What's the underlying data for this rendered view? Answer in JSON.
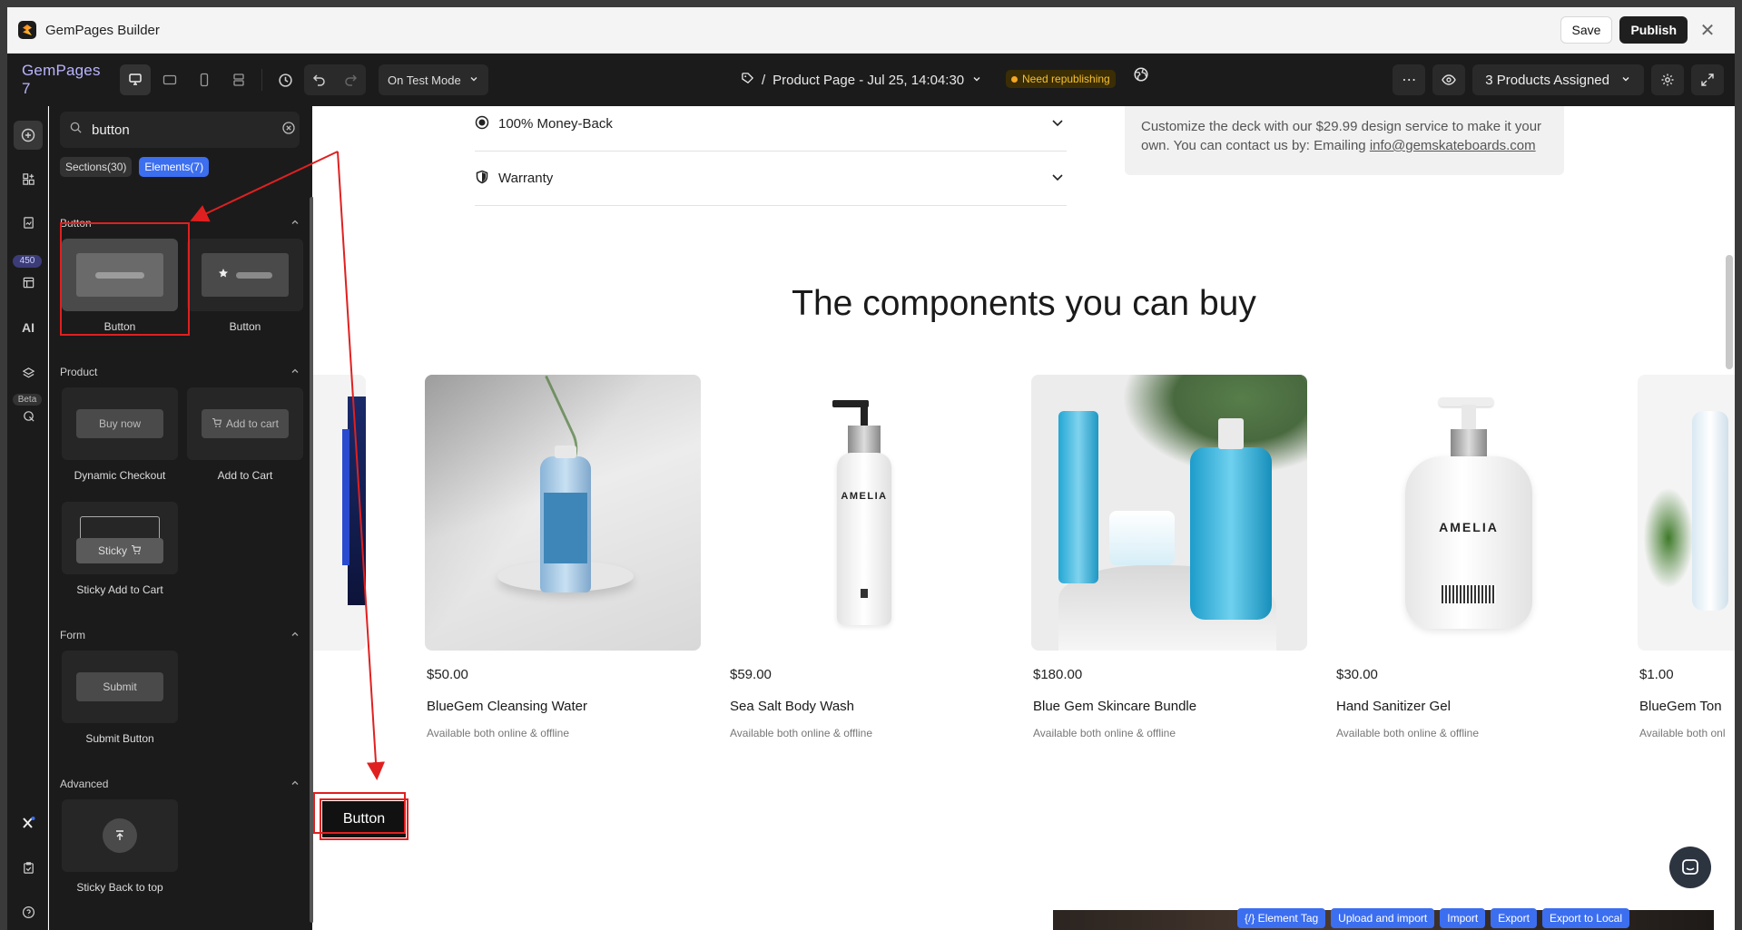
{
  "window": {
    "title": "GemPages Builder",
    "save_label": "Save",
    "publish_label": "Publish"
  },
  "toolbar": {
    "brand": "GemPages 7",
    "mode": "On Test Mode",
    "page_prefix": "/",
    "page_title": "Product Page - Jul 25, 14:04:30",
    "republish_badge": "Need republishing",
    "assigned": "3 Products Assigned"
  },
  "rail": {
    "badge_count": "450",
    "badge_beta": "Beta",
    "ai_label": "AI"
  },
  "panel": {
    "search_value": "button",
    "chips": [
      "Sections(30)",
      "Elements(7)"
    ],
    "groups": {
      "button": {
        "title": "Button",
        "items": [
          "Button",
          "Button"
        ]
      },
      "product": {
        "title": "Product",
        "items": [
          "Dynamic Checkout",
          "Add to Cart",
          "Sticky Add to Cart"
        ],
        "previews": [
          "Buy now",
          "Add to cart",
          "Sticky"
        ]
      },
      "form": {
        "title": "Form",
        "items": [
          "Submit Button"
        ],
        "previews": [
          "Submit"
        ]
      },
      "advanced": {
        "title": "Advanced",
        "items": [
          "Sticky Back to top"
        ]
      }
    }
  },
  "canvas": {
    "accordions": [
      "100% Money-Back",
      "Warranty"
    ],
    "info_text": "Customize the deck with our $29.99 design service to make it your own. You can contact us by: Emailing ",
    "info_email": "info@gemskateboards.com",
    "heading": "The components you can buy",
    "products": [
      {
        "price": "$50.00",
        "name": "BlueGem Cleansing Water",
        "avail": "Available both online & offline"
      },
      {
        "price": "$59.00",
        "name": "Sea Salt Body Wash",
        "avail": "Available both online & offline"
      },
      {
        "price": "$180.00",
        "name": "Blue Gem Skincare Bundle",
        "avail": "Available both online & offline"
      },
      {
        "price": "$30.00",
        "name": "Hand Sanitizer Gel",
        "avail": "Available both online & offline"
      },
      {
        "price": "$1.00",
        "name": "BlueGem Ton",
        "avail": "Available both onl"
      }
    ],
    "bottle_text": "AMELIA",
    "dropped_button": "Button"
  },
  "devtools": [
    "{/} Element Tag",
    "Upload and import",
    "Import",
    "Export",
    "Export to Local"
  ],
  "colors": {
    "accent": "#3c6ef0",
    "annotation": "#e02020",
    "dark": "#1b1b1b"
  }
}
